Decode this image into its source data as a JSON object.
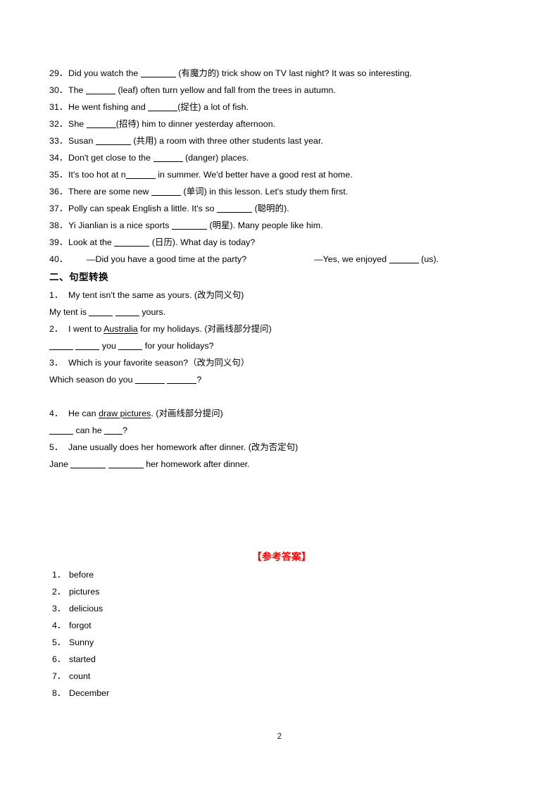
{
  "document": {
    "page_number": "2",
    "accent_color": "#ff0000",
    "text_color": "#000000",
    "background": "#ffffff"
  },
  "fill_in_blanks": {
    "items": [
      {
        "num": "29．",
        "pre": "Did you watch the ",
        "blank": "b-lg",
        "post": " (有魔力的) trick show on TV last night? It was so interesting."
      },
      {
        "num": "30．",
        "pre": "The ",
        "blank": "b-md",
        "post": " (leaf) often turn yellow and fall from the trees in autumn."
      },
      {
        "num": "31．",
        "pre": "He went fishing and ",
        "blank": "b-md",
        "post": "(捉住) a lot of fish."
      },
      {
        "num": "32．",
        "pre": "She ",
        "blank": "b-md",
        "post": "(招待) him to dinner yesterday afternoon."
      },
      {
        "num": "33．",
        "pre": "Susan ",
        "blank": "b-lg",
        "post": " (共用) a room with three other students last year."
      },
      {
        "num": "34．",
        "pre": "Don't get close to the ",
        "blank": "b-md",
        "post": " (danger) places."
      },
      {
        "num": "35．",
        "pre": "It's too hot at n",
        "blank": "b-md",
        "post": " in summer. We'd better have a good rest at home."
      },
      {
        "num": "36．",
        "pre": "There are some new ",
        "blank": "b-md",
        "post": " (单词) in this lesson. Let's study them first."
      },
      {
        "num": "37．",
        "pre": "Polly can speak English a little. It's so ",
        "blank": "b-lg",
        "post": " (聪明的)."
      },
      {
        "num": "38．",
        "pre": "Yi Jianlian is a nice sports ",
        "blank": "b-lg",
        "post": " (明星). Many people like him."
      },
      {
        "num": "39．",
        "pre": "Look at the ",
        "blank": "b-lg",
        "post": " (日历). What day is today?"
      }
    ],
    "item40": {
      "num": "40．",
      "left": "—Did you have a good time at the party?",
      "right_pre": "—Yes, we enjoyed ",
      "right_post": " (us)."
    }
  },
  "sentence_transform": {
    "heading": "二、句型转换",
    "items": [
      {
        "num": "1．",
        "question_pre": "My tent isn't the same as yours. (改为同义句)",
        "answer_pre": "My tent is ",
        "answer_mid": " ",
        "answer_post": " yours."
      },
      {
        "num": "2．",
        "q_pre": "I went to ",
        "q_underline": "Australia",
        "q_post": " for my holidays. (对画线部分提问)",
        "a_pre": "",
        "a_mid": " you ",
        "a_post": " for your holidays?"
      },
      {
        "num": "3．",
        "question": "Which is your favorite season?（改为同义句）",
        "answer_pre": "Which season do you ",
        "answer_post": "?"
      },
      {
        "num": "4．",
        "q_pre": "He can ",
        "q_underline": "draw pictures",
        "q_post": ". (对画线部分提问)",
        "a_mid": " can he ",
        "a_post": "?"
      },
      {
        "num": "5．",
        "question": "Jane usually does her homework after dinner. (改为否定句)",
        "answer_pre": "Jane ",
        "answer_post": " her homework after dinner."
      }
    ]
  },
  "answer_key": {
    "title": "【参考答案】",
    "items": [
      {
        "num": "1．",
        "text": "before"
      },
      {
        "num": "2．",
        "text": "pictures"
      },
      {
        "num": "3．",
        "text": "delicious"
      },
      {
        "num": "4．",
        "text": "forgot"
      },
      {
        "num": "5．",
        "text": "Sunny"
      },
      {
        "num": "6．",
        "text": "started"
      },
      {
        "num": "7．",
        "text": "count"
      },
      {
        "num": "8．",
        "text": "December"
      }
    ]
  }
}
